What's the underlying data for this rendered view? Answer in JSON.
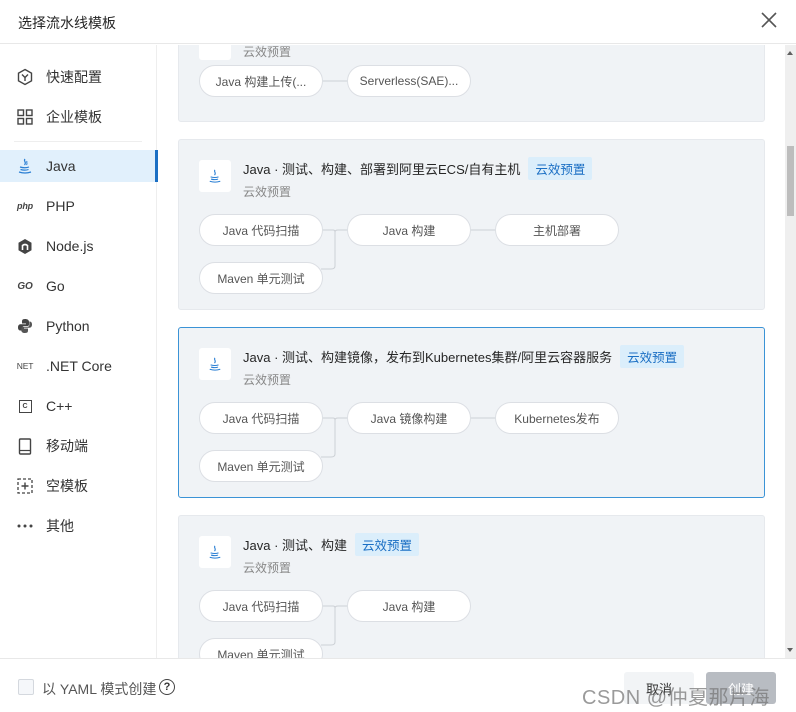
{
  "dialog": {
    "title": "选择流水线模板"
  },
  "sidebar": {
    "items": [
      {
        "label": "快速配置",
        "icon": "quick-config-icon"
      },
      {
        "label": "企业模板",
        "icon": "enterprise-template-icon"
      },
      {
        "label": "Java",
        "icon": "java-icon",
        "active": true
      },
      {
        "label": "PHP",
        "icon": "php-icon",
        "icon_text": "php"
      },
      {
        "label": "Node.js",
        "icon": "nodejs-icon"
      },
      {
        "label": "Go",
        "icon": "go-icon",
        "icon_text": "GO"
      },
      {
        "label": "Python",
        "icon": "python-icon"
      },
      {
        "label": ".NET Core",
        "icon": "dotnet-icon",
        "icon_text": "NET"
      },
      {
        "label": "C++",
        "icon": "cpp-icon",
        "icon_text": "C"
      },
      {
        "label": "移动端",
        "icon": "mobile-icon"
      },
      {
        "label": "空模板",
        "icon": "empty-template-icon"
      },
      {
        "label": "其他",
        "icon": "more-icon"
      }
    ]
  },
  "templates": [
    {
      "title": "",
      "subtitle": "云效预置",
      "steps": [
        "Java 构建上传(...",
        "Serverless(SAE)..."
      ]
    },
    {
      "title": "Java · 测试、构建、部署到阿里云ECS/自有主机",
      "tag": "云效预置",
      "subtitle": "云效预置",
      "steps": [
        "Java 代码扫描",
        "Java 构建",
        "主机部署",
        "Maven 单元测试"
      ]
    },
    {
      "title": "Java · 测试、构建镜像，发布到Kubernetes集群/阿里云容器服务",
      "tag": "云效预置",
      "subtitle": "云效预置",
      "selected": true,
      "steps": [
        "Java 代码扫描",
        "Java 镜像构建",
        "Kubernetes发布",
        "Maven 单元测试"
      ]
    },
    {
      "title": "Java · 测试、构建",
      "tag": "云效预置",
      "subtitle": "云效预置",
      "steps": [
        "Java 代码扫描",
        "Java 构建",
        "Maven 单元测试"
      ]
    }
  ],
  "footer": {
    "yaml_checkbox_label": "以 YAML 模式创建",
    "yaml_checked": false,
    "help_glyph": "?",
    "cancel_label": "取消",
    "create_label": "创建"
  },
  "watermark": "CSDN @仲夏那片海",
  "colors": {
    "accent": "#1b6fc4",
    "active_bg": "#e1f0fc",
    "tag_bg": "#dbeefb",
    "card_bg": "#f0f3f6",
    "selected_border": "#3b93d6"
  }
}
